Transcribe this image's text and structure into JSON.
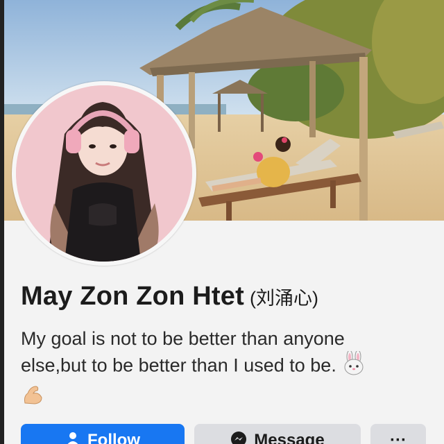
{
  "profile": {
    "name": "May Zon Zon Htet",
    "alt_name": "(刘涌心)",
    "bio_line1": "My goal is not to be better than anyone",
    "bio_line2": "else,but to be better than I used to be."
  },
  "actions": {
    "follow_label": "Follow",
    "message_label": "Message",
    "more_label": "···"
  },
  "icons": {
    "bio_emoji_1": "rabbit-face-icon",
    "bio_emoji_2": "flexed-biceps-icon",
    "follow_icon": "follow-person-icon",
    "message_icon": "messenger-icon"
  },
  "colors": {
    "follow_button": "#1877f2",
    "secondary_button": "#dcdde1",
    "text": "#1c1c1c"
  }
}
